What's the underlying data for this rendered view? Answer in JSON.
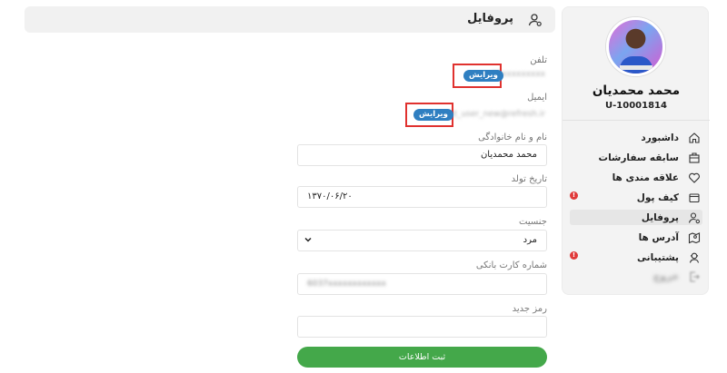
{
  "header": {
    "title": "پروفایل",
    "icon": "user-gear-icon"
  },
  "sidebar": {
    "user_name": "محمد محمدیان",
    "user_code": "U-10001814",
    "items": [
      {
        "label": "داشبورد",
        "icon": "home-icon"
      },
      {
        "label": "سابقه سفارشات",
        "icon": "orders-icon"
      },
      {
        "label": "علاقه مندی ها",
        "icon": "heart-icon"
      },
      {
        "label": "کیف پول",
        "icon": "wallet-icon",
        "badge": "!"
      },
      {
        "label": "پروفایل",
        "icon": "user-gear-icon",
        "active": true
      },
      {
        "label": "آدرس ها",
        "icon": "map-icon"
      },
      {
        "label": "پشتیبانی",
        "icon": "support-icon",
        "badge": "!"
      },
      {
        "label": "خروج",
        "icon": "logout-icon",
        "blurred": true
      }
    ]
  },
  "form": {
    "phone": {
      "label": "تلفن",
      "value": "09xxxxxxxxx",
      "edit_label": "ویرایش"
    },
    "email": {
      "label": "ایمیل",
      "value": "test_user_new@refresh.ir",
      "edit_label": "ویرایش"
    },
    "full_name": {
      "label": "نام و نام خانوادگی",
      "value": "محمد محمدیان"
    },
    "birth_date": {
      "label": "تاریخ تولد",
      "value": "۱۳۷۰/۰۶/۲۰"
    },
    "gender": {
      "label": "جنسیت",
      "value": "مرد"
    },
    "bank_card": {
      "label": "شماره کارت بانکی",
      "value": "6037xxxxxxxxxxxx"
    },
    "new_password": {
      "label": "رمز جدید",
      "value": ""
    },
    "submit_label": "ثبت اطلاعات"
  },
  "colors": {
    "accent_green": "#44a84a",
    "edit_blue": "#2f7fc1",
    "highlight_red": "#e0322f",
    "badge_red": "#e03a3a"
  }
}
